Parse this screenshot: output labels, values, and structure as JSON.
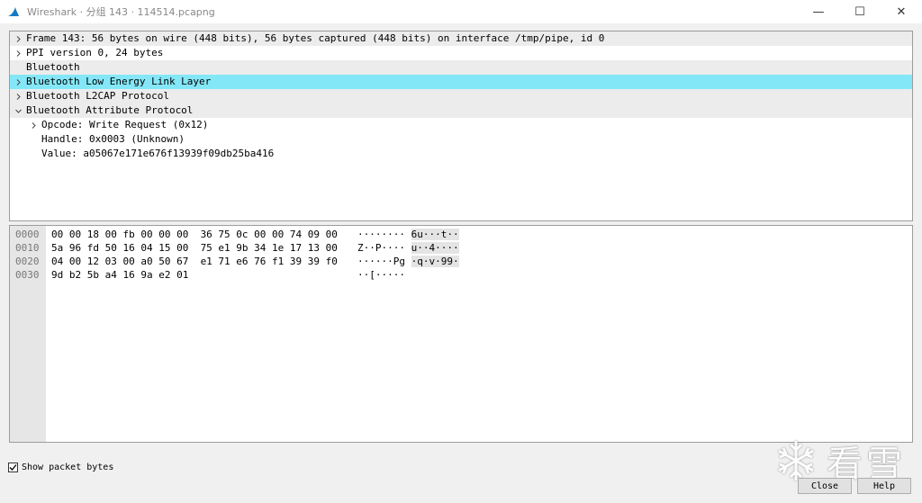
{
  "window": {
    "title": "Wireshark · 分组 143 · 114514.pcapng",
    "minimize_label": "—",
    "maximize_label": "☐",
    "close_label": "✕"
  },
  "tree": [
    {
      "label": "Frame 143: 56 bytes on wire (448 bits), 56 bytes captured (448 bits) on interface /tmp/pipe, id 0",
      "arrow": "right",
      "indent": 0,
      "state": "shaded"
    },
    {
      "label": "PPI version 0, 24 bytes",
      "arrow": "right",
      "indent": 0,
      "state": "normal"
    },
    {
      "label": "Bluetooth",
      "arrow": "none",
      "indent": 0,
      "state": "shaded"
    },
    {
      "label": "Bluetooth Low Energy Link Layer",
      "arrow": "right",
      "indent": 0,
      "state": "selected"
    },
    {
      "label": "Bluetooth L2CAP Protocol",
      "arrow": "right",
      "indent": 0,
      "state": "shaded"
    },
    {
      "label": "Bluetooth Attribute Protocol",
      "arrow": "down",
      "indent": 0,
      "state": "shaded"
    },
    {
      "label": "Opcode: Write Request (0x12)",
      "arrow": "right",
      "indent": 1,
      "state": "normal"
    },
    {
      "label": "Handle: 0x0003 (Unknown)",
      "arrow": "none",
      "indent": 1,
      "state": "normal"
    },
    {
      "label": "Value: a05067e171e676f13939f09db25ba416",
      "arrow": "none",
      "indent": 1,
      "state": "normal"
    }
  ],
  "hex_rows": [
    {
      "offset": "0000",
      "bytes": "00 00 18 00 fb 00 00 00  36 75 0c 00 00 74 09 00",
      "ascii_a": "········ ",
      "ascii_b": "6u···t··"
    },
    {
      "offset": "0010",
      "bytes": "5a 96 fd 50 16 04 15 00  75 e1 9b 34 1e 17 13 00",
      "ascii_a": "Z··P···· ",
      "ascii_b": "u··4····"
    },
    {
      "offset": "0020",
      "bytes": "04 00 12 03 00 a0 50 67  e1 71 e6 76 f1 39 39 f0",
      "ascii_a": "······Pg ",
      "ascii_b": "·q·v·99·"
    },
    {
      "offset": "0030",
      "bytes": "9d b2 5b a4 16 9a e2 01",
      "ascii_a": "··[·····",
      "ascii_b": ""
    }
  ],
  "footer": {
    "show_bytes_label": "Show packet bytes",
    "show_bytes_checked": true,
    "close_label": "Close",
    "help_label": "Help"
  },
  "watermark": {
    "text": "看雪"
  },
  "colors": {
    "selected_row": "#84e7f7",
    "shaded_row": "#ececec",
    "offset_column": "#e6e6e6"
  }
}
